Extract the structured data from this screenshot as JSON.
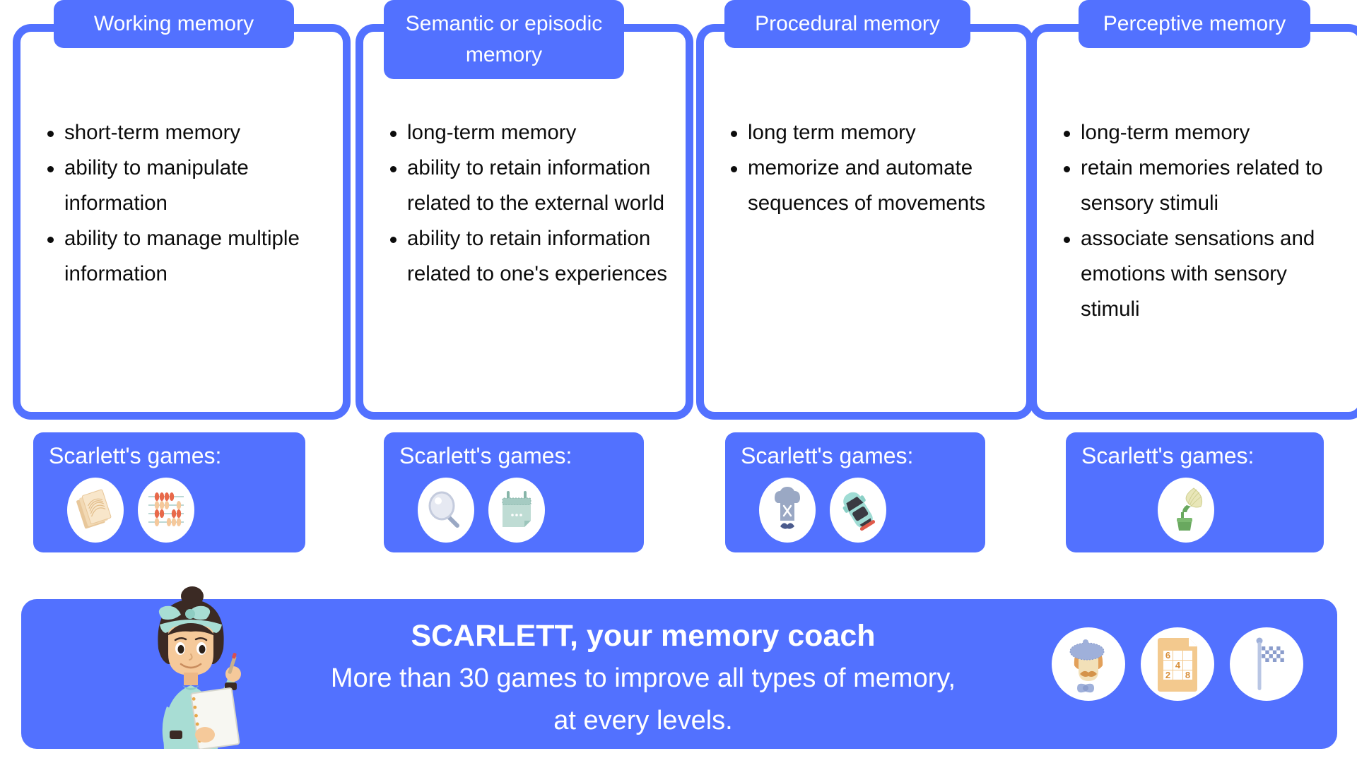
{
  "theme": {
    "accent": "#5271FF",
    "text": "#0c0c0c",
    "card_bg": "#ffffff",
    "page_bg": "#ffffff"
  },
  "cards": [
    {
      "title": "Working memory",
      "bullets": [
        "short-term memory",
        "ability to manipulate information",
        "ability to manage multiple information"
      ]
    },
    {
      "title": "Semantic or episodic memory",
      "bullets": [
        "long-term memory",
        "ability to retain information related to the external world",
        "ability to retain information related to one's experiences"
      ]
    },
    {
      "title": "Procedural memory",
      "bullets": [
        "long term memory",
        "memorize and automate sequences of movements"
      ]
    },
    {
      "title": "Perceptive memory",
      "bullets": [
        "long-term memory",
        "retain memories related to sensory stimuli",
        "associate sensations and emotions with sensory stimuli"
      ]
    }
  ],
  "games": [
    {
      "label": "Scarlett's games:",
      "icons": [
        "cards-icon",
        "abacus-icon"
      ]
    },
    {
      "label": "Scarlett's games:",
      "icons": [
        "magnifier-icon",
        "calendar-icon"
      ]
    },
    {
      "label": "Scarlett's games:",
      "icons": [
        "chef-icon",
        "car-icon"
      ]
    },
    {
      "label": "Scarlett's games:",
      "icons": [
        "gramophone-icon"
      ]
    }
  ],
  "banner": {
    "title": "SCARLETT, your memory coach",
    "subtitle": "More than 30 games to improve all types of memory, at every levels.",
    "avatar": "scarlett-coach-avatar",
    "icons": [
      "gentleman-face-icon",
      "sudoku-grid-icon",
      "checkered-flag-icon"
    ],
    "sudoku_numbers": [
      "6",
      "",
      "",
      "",
      "4",
      "",
      "2",
      "",
      "8"
    ]
  }
}
